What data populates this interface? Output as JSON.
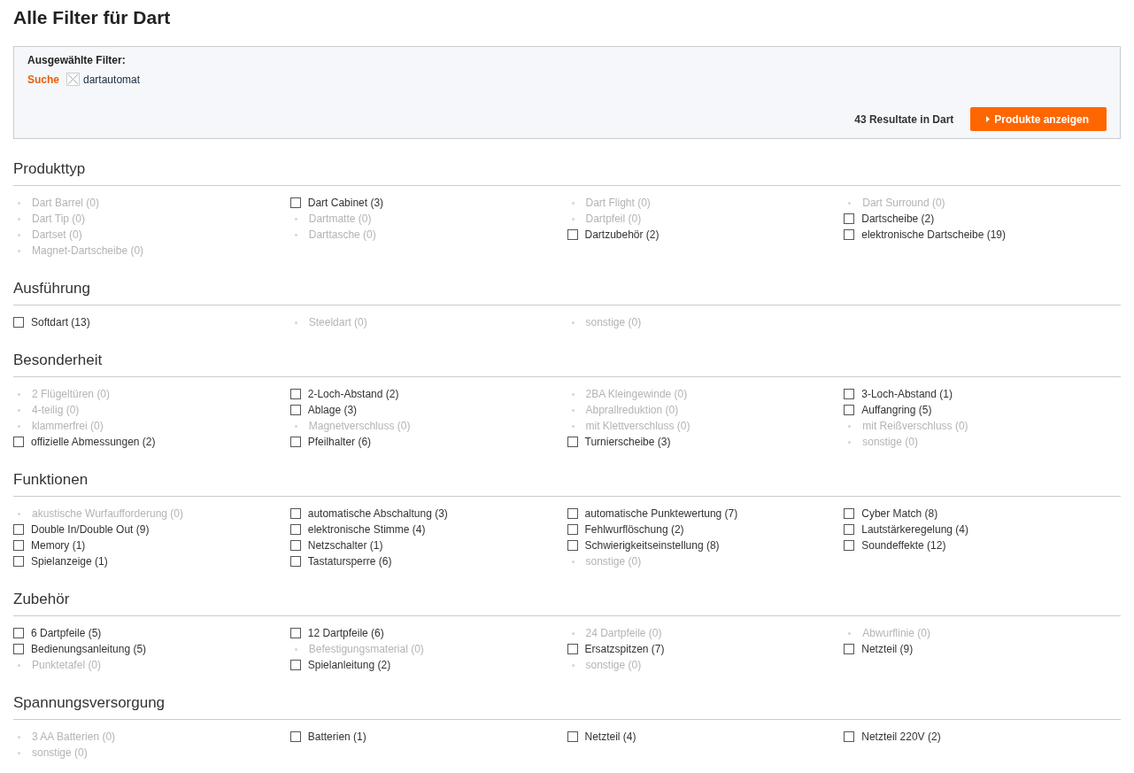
{
  "title": "Alle Filter für Dart",
  "selected_filters": {
    "heading": "Ausgewählte Filter:",
    "label": "Suche",
    "value": "dartautomat",
    "results": "43 Resultate in Dart",
    "button": "Produkte anzeigen"
  },
  "groups": [
    {
      "title": "Produkttyp",
      "items": [
        {
          "label": "Dart Barrel (0)",
          "disabled": true
        },
        {
          "label": "Dart Cabinet (3)",
          "disabled": false,
          "checked": false
        },
        {
          "label": "Dart Flight (0)",
          "disabled": true
        },
        {
          "label": "Dart Surround (0)",
          "disabled": true
        },
        {
          "label": "Dart Tip (0)",
          "disabled": true
        },
        {
          "label": "Dartmatte (0)",
          "disabled": true
        },
        {
          "label": "Dartpfeil (0)",
          "disabled": true
        },
        {
          "label": "Dartscheibe (2)",
          "disabled": false,
          "checked": false
        },
        {
          "label": "Dartset (0)",
          "disabled": true
        },
        {
          "label": "Darttasche (0)",
          "disabled": true
        },
        {
          "label": "Dartzubehör (2)",
          "disabled": false,
          "checked": false
        },
        {
          "label": "elektronische Dartscheibe (19)",
          "disabled": false,
          "checked": false
        },
        {
          "label": "Magnet-Dartscheibe (0)",
          "disabled": true
        }
      ]
    },
    {
      "title": "Ausführung",
      "items": [
        {
          "label": "Softdart (13)",
          "disabled": false,
          "checked": false
        },
        {
          "label": "Steeldart (0)",
          "disabled": true
        },
        {
          "label": "sonstige (0)",
          "disabled": true
        }
      ]
    },
    {
      "title": "Besonderheit",
      "items": [
        {
          "label": "2 Flügeltüren (0)",
          "disabled": true
        },
        {
          "label": "2-Loch-Abstand (2)",
          "disabled": false,
          "checked": false
        },
        {
          "label": "2BA Kleingewinde (0)",
          "disabled": true
        },
        {
          "label": "3-Loch-Abstand (1)",
          "disabled": false,
          "checked": false
        },
        {
          "label": "4-teilig (0)",
          "disabled": true
        },
        {
          "label": "Ablage (3)",
          "disabled": false,
          "checked": false
        },
        {
          "label": "Abprallreduktion (0)",
          "disabled": true
        },
        {
          "label": "Auffangring (5)",
          "disabled": false,
          "checked": false
        },
        {
          "label": "klammerfrei (0)",
          "disabled": true
        },
        {
          "label": "Magnetverschluss (0)",
          "disabled": true
        },
        {
          "label": "mit Klettverschluss (0)",
          "disabled": true
        },
        {
          "label": "mit Reißverschluss (0)",
          "disabled": true
        },
        {
          "label": "offizielle Abmessungen (2)",
          "disabled": false,
          "checked": false
        },
        {
          "label": "Pfeilhalter (6)",
          "disabled": false,
          "checked": false
        },
        {
          "label": "Turnierscheibe (3)",
          "disabled": false,
          "checked": false
        },
        {
          "label": "sonstige (0)",
          "disabled": true
        }
      ]
    },
    {
      "title": "Funktionen",
      "items": [
        {
          "label": "akustische Wurfaufforderung (0)",
          "disabled": true
        },
        {
          "label": "automatische Abschaltung (3)",
          "disabled": false,
          "checked": false
        },
        {
          "label": "automatische Punktewertung (7)",
          "disabled": false,
          "checked": false
        },
        {
          "label": "Cyber Match (8)",
          "disabled": false,
          "checked": false
        },
        {
          "label": "Double In/Double Out (9)",
          "disabled": false,
          "checked": false
        },
        {
          "label": "elektronische Stimme (4)",
          "disabled": false,
          "checked": false
        },
        {
          "label": "Fehlwurflöschung (2)",
          "disabled": false,
          "checked": false
        },
        {
          "label": "Lautstärkeregelung (4)",
          "disabled": false,
          "checked": false
        },
        {
          "label": "Memory (1)",
          "disabled": false,
          "checked": false
        },
        {
          "label": "Netzschalter (1)",
          "disabled": false,
          "checked": false
        },
        {
          "label": "Schwierigkeitseinstellung (8)",
          "disabled": false,
          "checked": false
        },
        {
          "label": "Soundeffekte (12)",
          "disabled": false,
          "checked": false
        },
        {
          "label": "Spielanzeige (1)",
          "disabled": false,
          "checked": false
        },
        {
          "label": "Tastatursperre (6)",
          "disabled": false,
          "checked": false
        },
        {
          "label": "sonstige (0)",
          "disabled": true
        }
      ]
    },
    {
      "title": "Zubehör",
      "items": [
        {
          "label": "6 Dartpfeile (5)",
          "disabled": false,
          "checked": false
        },
        {
          "label": "12 Dartpfeile (6)",
          "disabled": false,
          "checked": false
        },
        {
          "label": "24 Dartpfeile (0)",
          "disabled": true
        },
        {
          "label": "Abwurflinie (0)",
          "disabled": true
        },
        {
          "label": "Bedienungsanleitung (5)",
          "disabled": false,
          "checked": false
        },
        {
          "label": "Befestigungsmaterial (0)",
          "disabled": true
        },
        {
          "label": "Ersatzspitzen (7)",
          "disabled": false,
          "checked": false
        },
        {
          "label": "Netzteil (9)",
          "disabled": false,
          "checked": false
        },
        {
          "label": "Punktetafel (0)",
          "disabled": true
        },
        {
          "label": "Spielanleitung (2)",
          "disabled": false,
          "checked": false
        },
        {
          "label": "sonstige (0)",
          "disabled": true
        }
      ]
    },
    {
      "title": "Spannungsversorgung",
      "items": [
        {
          "label": "3 AA Batterien (0)",
          "disabled": true
        },
        {
          "label": "Batterien (1)",
          "disabled": false,
          "checked": false
        },
        {
          "label": "Netzteil (4)",
          "disabled": false,
          "checked": false
        },
        {
          "label": "Netzteil 220V (2)",
          "disabled": false,
          "checked": false
        },
        {
          "label": "sonstige (0)",
          "disabled": true
        }
      ]
    }
  ]
}
